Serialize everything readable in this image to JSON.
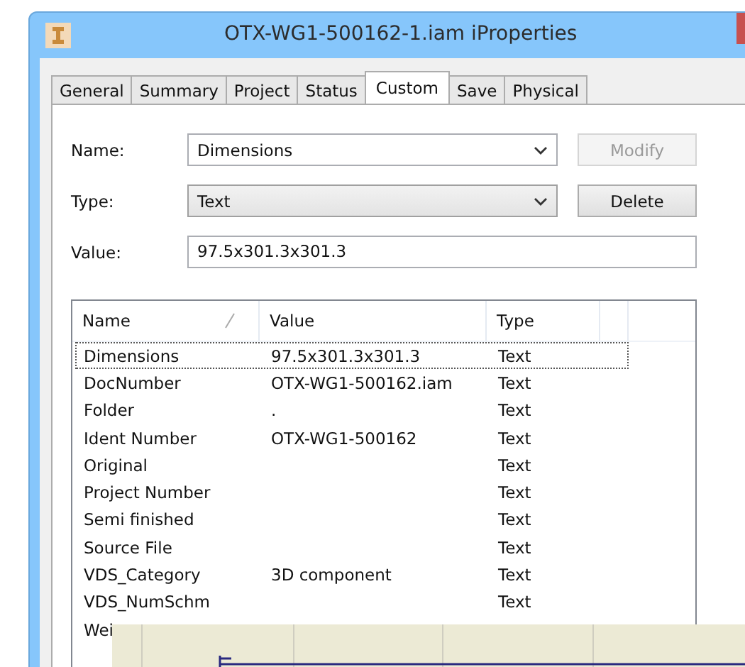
{
  "window": {
    "title": "OTX-WG1-500162-1.iam iProperties"
  },
  "tabs": [
    {
      "label": "General",
      "selected": false
    },
    {
      "label": "Summary",
      "selected": false
    },
    {
      "label": "Project",
      "selected": false
    },
    {
      "label": "Status",
      "selected": false
    },
    {
      "label": "Custom",
      "selected": true
    },
    {
      "label": "Save",
      "selected": false
    },
    {
      "label": "Physical",
      "selected": false
    }
  ],
  "form": {
    "name_label": "Name:",
    "name_value": "Dimensions",
    "modify_button": {
      "label": "Modify",
      "disabled": true
    },
    "type_label": "Type:",
    "type_value": "Text",
    "delete_button": {
      "label": "Delete",
      "disabled": false
    },
    "value_label": "Value:",
    "value": "97.5x301.3x301.3"
  },
  "table": {
    "columns": [
      "Name",
      "Value",
      "Type"
    ],
    "rows": [
      {
        "name": "Dimensions",
        "value": "97.5x301.3x301.3",
        "type": "Text",
        "selected": true
      },
      {
        "name": "DocNumber",
        "value": "OTX-WG1-500162.iam",
        "type": "Text",
        "selected": false
      },
      {
        "name": "Folder",
        "value": ".",
        "type": "Text",
        "selected": false
      },
      {
        "name": "Ident Number",
        "value": "OTX-WG1-500162",
        "type": "Text",
        "selected": false
      },
      {
        "name": "Original",
        "value": "",
        "type": "Text",
        "selected": false
      },
      {
        "name": "Project Number",
        "value": "",
        "type": "Text",
        "selected": false
      },
      {
        "name": "Semi finished",
        "value": "",
        "type": "Text",
        "selected": false
      },
      {
        "name": "Source File",
        "value": "",
        "type": "Text",
        "selected": false
      },
      {
        "name": "VDS_Category",
        "value": "3D component",
        "type": "Text",
        "selected": false
      },
      {
        "name": "VDS_NumSchm",
        "value": "",
        "type": "Text",
        "selected": false
      },
      {
        "name": "Wei",
        "value": "",
        "type": "",
        "selected": false
      }
    ]
  }
}
